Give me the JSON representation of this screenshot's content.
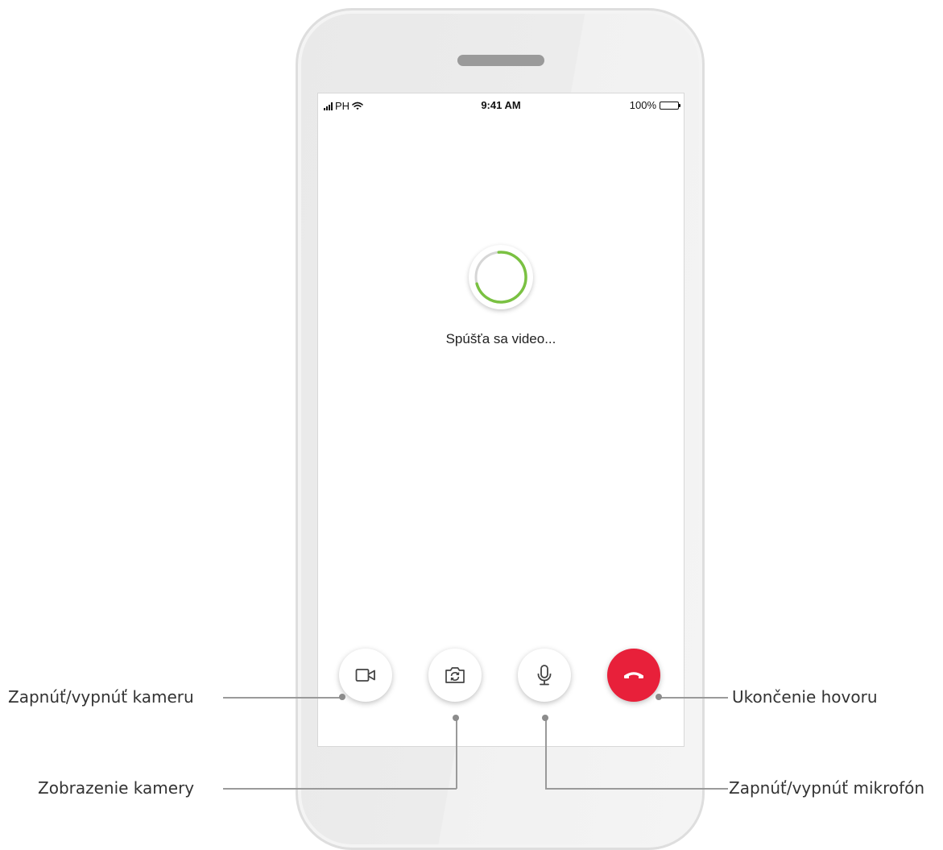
{
  "status_bar": {
    "carrier": "PH",
    "time": "9:41 AM",
    "battery_percent": "100%"
  },
  "main": {
    "loading_text": "Spúšťa sa video...",
    "spinner_progress": 0.72
  },
  "controls": {
    "camera_toggle_icon": "video-camera-icon",
    "camera_switch_icon": "camera-switch-icon",
    "mic_toggle_icon": "microphone-icon",
    "end_call_icon": "phone-hangup-icon"
  },
  "callouts": {
    "camera_toggle": "Zapnúť/vypnúť kameru",
    "camera_view": "Zobrazenie kamery",
    "end_call": "Ukončenie hovoru",
    "mic_toggle": "Zapnúť/vypnúť mikrofón"
  },
  "colors": {
    "end_call": "#e8203a",
    "spinner_progress": "#7ac142",
    "spinner_track": "#d6d6d6"
  }
}
